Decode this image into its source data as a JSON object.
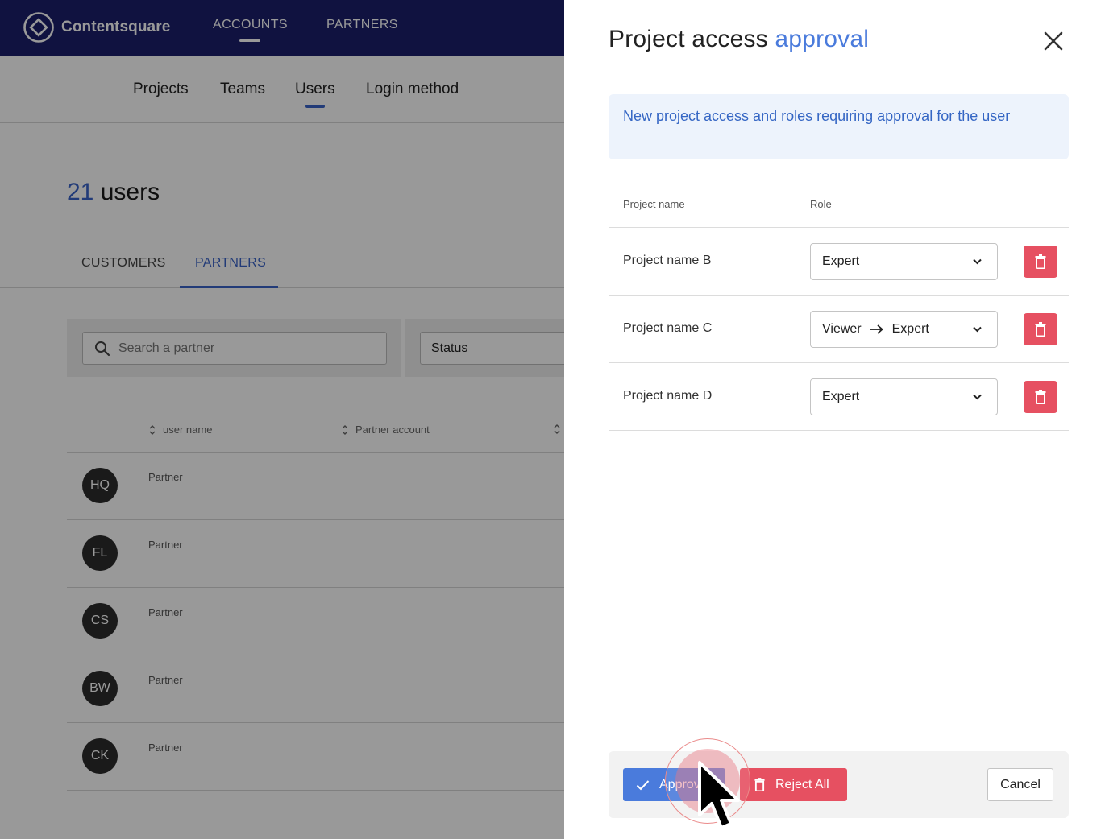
{
  "app": {
    "brand": "Contentsquare",
    "topnav": [
      {
        "label": "ACCOUNTS",
        "active": true
      },
      {
        "label": "PARTNERS",
        "active": false
      }
    ],
    "subnav": [
      {
        "label": "Projects"
      },
      {
        "label": "Teams"
      },
      {
        "label": "Users",
        "active": true
      },
      {
        "label": "Login method"
      }
    ],
    "users_count": "21",
    "users_label": "users",
    "tabs": [
      {
        "label": "CUSTOMERS"
      },
      {
        "label": "PARTNERS",
        "active": true
      }
    ],
    "search": {
      "placeholder": "Search a partner"
    },
    "status_filter": {
      "label": "Status"
    },
    "columns": [
      "user name",
      "Partner account"
    ],
    "rows": [
      {
        "initials": "HQ",
        "type": "Partner"
      },
      {
        "initials": "FL",
        "type": "Partner"
      },
      {
        "initials": "CS",
        "type": "Partner"
      },
      {
        "initials": "BW",
        "type": "Partner"
      },
      {
        "initials": "CK",
        "type": "Partner"
      }
    ]
  },
  "panel": {
    "title_prefix": "Project access",
    "title_accent": "approval",
    "info": "New project access and roles requiring approval for the user",
    "headers": {
      "project": "Project name",
      "role": "Role"
    },
    "projects": [
      {
        "name": "Project name B",
        "role": "Expert",
        "from_role": ""
      },
      {
        "name": "Project name C",
        "role": "Expert",
        "from_role": "Viewer"
      },
      {
        "name": "Project name D",
        "role": "Expert",
        "from_role": ""
      }
    ],
    "actions": {
      "approve": "Approve",
      "reject_all": "Reject All",
      "cancel": "Cancel"
    }
  },
  "colors": {
    "navy": "#1b1f6b",
    "accent": "#4a7bdc",
    "danger": "#e65061"
  }
}
